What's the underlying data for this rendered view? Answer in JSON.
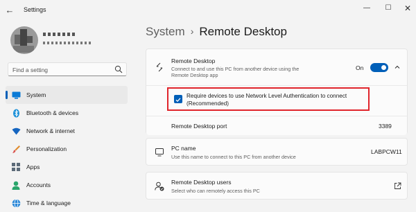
{
  "window": {
    "title": "Settings",
    "back_glyph": "←",
    "min_glyph": "—",
    "max_glyph": "☐",
    "close_glyph": "✕"
  },
  "search": {
    "placeholder": "Find a setting"
  },
  "sidebar": {
    "items": [
      {
        "label": "System",
        "icon": "system-icon",
        "selected": true
      },
      {
        "label": "Bluetooth & devices",
        "icon": "bluetooth-icon"
      },
      {
        "label": "Network & internet",
        "icon": "wifi-icon"
      },
      {
        "label": "Personalization",
        "icon": "brush-icon"
      },
      {
        "label": "Apps",
        "icon": "apps-icon"
      },
      {
        "label": "Accounts",
        "icon": "accounts-icon"
      },
      {
        "label": "Time & language",
        "icon": "globe-icon"
      }
    ]
  },
  "breadcrumb": {
    "parent": "System",
    "separator": "›",
    "current": "Remote Desktop"
  },
  "remote_desktop": {
    "title": "Remote Desktop",
    "description": "Connect to and use this PC from another device using the Remote Desktop app",
    "toggle_label": "On",
    "toggle_on": true,
    "nla_text": "Require devices to use Network Level Authentication to connect (Recommended)",
    "nla_checked": true,
    "port_label": "Remote Desktop port",
    "port_value": "3389"
  },
  "pc_name": {
    "title": "PC name",
    "description": "Use this name to connect to this PC from another device",
    "value": "LABPCW11"
  },
  "users": {
    "title": "Remote Desktop users",
    "description": "Select who can remotely access this PC"
  },
  "colors": {
    "accent": "#005fb8",
    "highlight": "#e0242b",
    "background": "#f3f3f3"
  }
}
